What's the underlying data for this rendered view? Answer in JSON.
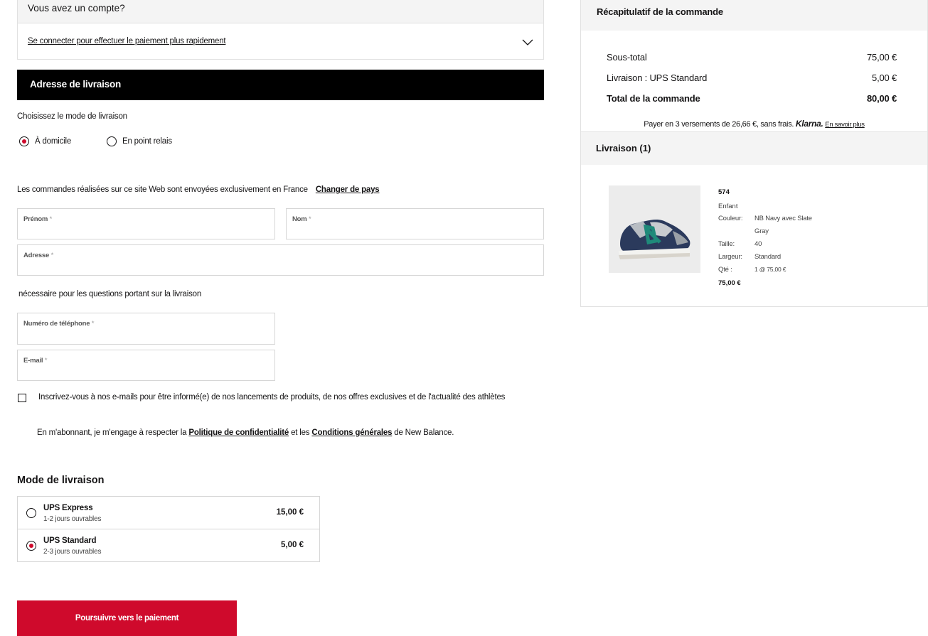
{
  "account": {
    "title": "Vous avez un compte?",
    "login_link": "Se connecter pour effectuer le paiement plus rapidement"
  },
  "shipping": {
    "header": "Adresse de livraison",
    "choose_mode": "Choisissez le mode de livraison",
    "opt_home": "À domicile",
    "opt_relay": "En point relais",
    "france_notice": "Les commandes réalisées sur ce site Web sont envoyées exclusivement en France",
    "change_country": "Changer de pays",
    "required_mark": "*",
    "fields": {
      "first_name": "Prénom",
      "last_name": "Nom",
      "address": "Adresse",
      "phone": "Numéro de téléphone",
      "email": "E-mail"
    },
    "phone_note": "nécessaire pour les questions portant sur la livraison",
    "newsletter": "Inscrivez-vous à nos e-mails pour être informé(e) de nos lancements de produits, de nos offres exclusives et de l'actualité des athlètes",
    "terms_pre": "En m'abonnant, je m'engage à respecter la ",
    "privacy": "Politique de confidentialité",
    "terms_mid": " et les ",
    "conditions": "Conditions générales",
    "terms_post": " de New Balance."
  },
  "delivery_mode": {
    "title": "Mode de livraison",
    "options": [
      {
        "name": "UPS Express",
        "sub": "1-2 jours ouvrables",
        "price": "15,00 €",
        "selected": false
      },
      {
        "name": "UPS Standard",
        "sub": "2-3 jours ouvrables",
        "price": "5,00 €",
        "selected": true
      }
    ]
  },
  "pay_button": "Poursuivre vers le paiement",
  "summary": {
    "title": "Récapitulatif de la commande",
    "subtotal_label": "Sous-total",
    "subtotal": "75,00 €",
    "shipping_label": "Livraison : UPS Standard",
    "shipping": "5,00 €",
    "total_label": "Total de la commande",
    "total": "80,00 €",
    "klarna_text": "Payer en 3 versements de 26,66 €, sans frais.",
    "klarna_logo": "Klarna.",
    "klarna_link": "En savoir plus",
    "delivery_title": "Livraison (1)",
    "product": {
      "name": "574",
      "category": "Enfant",
      "color_label": "Couleur:",
      "color": "NB Navy avec Slate",
      "color2": "Gray",
      "size_label": "Taille:",
      "size": "40",
      "width_label": "Largeur:",
      "width": "Standard",
      "qty_label": "Qté :",
      "qty": "1 @ 75,00 €",
      "price": "75,00 €"
    }
  },
  "colors": {
    "accent": "#cf0a2c",
    "header_bg": "#000000",
    "panel_bg": "#f4f4f4"
  }
}
